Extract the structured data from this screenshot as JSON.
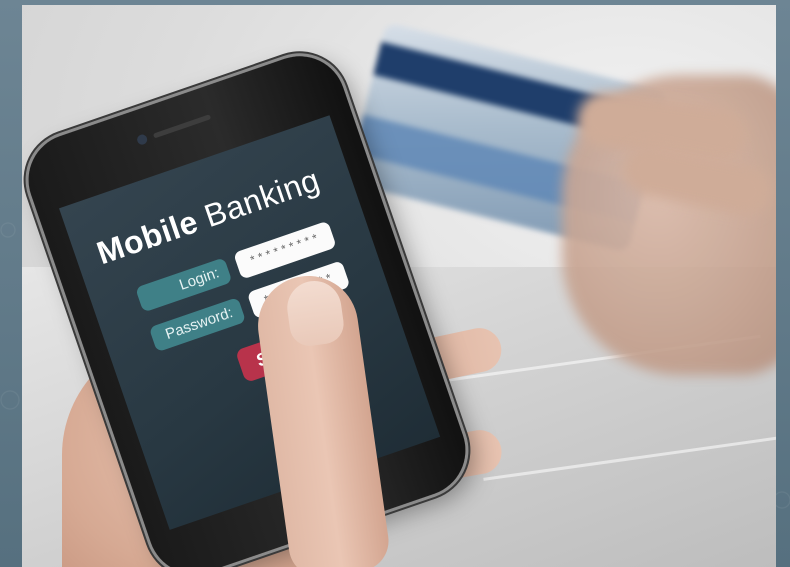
{
  "app": {
    "title_bold": "Mobile",
    "title_rest": "Banking",
    "login_label": "Login:",
    "login_value": "*********",
    "password_label": "Password:",
    "password_value": "*********",
    "submit_label": "SUBMIT"
  },
  "colors": {
    "frame": "#5f7888",
    "screen": "#2c3c46",
    "label_bg": "#3f8087",
    "submit_bg": "#b8334b",
    "card_stripe": "#1f3e6b"
  }
}
